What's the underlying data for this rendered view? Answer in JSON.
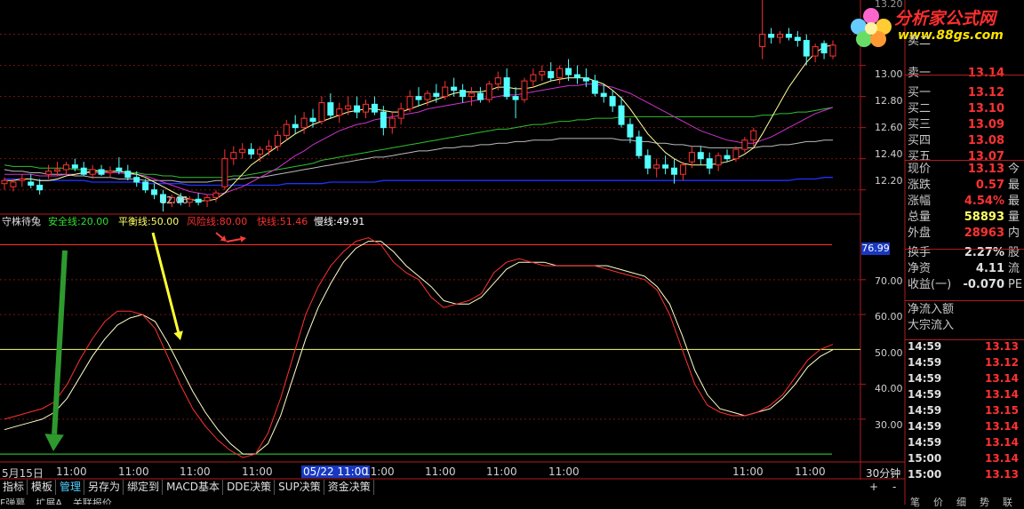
{
  "colors": {
    "up": "#ff3232",
    "down": "#54ffff",
    "red": "#ff3030",
    "yellow": "#ffff66",
    "green": "#30c030",
    "purple": "#cc33cc",
    "white": "#dddddd",
    "blue": "#2030ff",
    "grid": "#7a1414"
  },
  "price_panel": {
    "y_ticks": [
      "13.00",
      "12.80",
      "12.60",
      "12.40",
      "12.20"
    ],
    "top_tick_partial": "13.20",
    "low_marker": "12.06"
  },
  "indicator": {
    "name": "守株待兔",
    "lines": [
      {
        "label": "安全线:",
        "value": "20.00",
        "color": "#30e030"
      },
      {
        "label": "平衡线:",
        "value": "50.00",
        "color": "#ffff66"
      },
      {
        "label": "风险线:",
        "value": "80.00",
        "color": "#ff3030"
      },
      {
        "label": "快线:",
        "value": "51.46",
        "color": "#ff3030"
      },
      {
        "label": "慢线:",
        "value": "49.91",
        "color": "#ffffff"
      }
    ],
    "y_ticks": [
      "70.00",
      "60.00",
      "50.00",
      "40.00",
      "30.00"
    ],
    "current_value_box": "76.99"
  },
  "time_axis": {
    "labels": [
      "5月15日",
      "11:00",
      "11:00",
      "11:00",
      "11:00",
      "05/22 11:00",
      "11:00",
      "11:00",
      "11:00",
      "11:00",
      "11:00",
      "11:00"
    ],
    "highlight_index": 5,
    "period": "30分钟"
  },
  "tabs": [
    "指标",
    "模板",
    "管理",
    "另存为",
    "绑定到",
    "MACD基本",
    "DDE决策",
    "SUP决策",
    "资金决策"
  ],
  "tabs_row2": [
    "F弹幕",
    "扩展A",
    "关联报价"
  ],
  "active_tab_index": 2,
  "scroll_controls": [
    "+",
    "-"
  ],
  "logo": {
    "title": "分析家公式网",
    "url": "www.88gs.com"
  },
  "quote": {
    "order_book": [
      {
        "k": "卖二",
        "v": "",
        "c": "#ff3232"
      },
      {
        "k": "卖一",
        "v": "13.14",
        "c": "#ff3232"
      },
      {
        "k": "买一",
        "v": "13.12",
        "c": "#ff3232"
      },
      {
        "k": "买二",
        "v": "13.10",
        "c": "#ff3232"
      },
      {
        "k": "买三",
        "v": "13.09",
        "c": "#ff3232"
      },
      {
        "k": "买四",
        "v": "13.08",
        "c": "#ff3232"
      },
      {
        "k": "买五",
        "v": "13.07",
        "c": "#ff3232"
      }
    ],
    "stats": [
      {
        "k": "现价",
        "v": "13.13",
        "c": "#ff3232",
        "ex": "今"
      },
      {
        "k": "涨跌",
        "v": "0.57",
        "c": "#ff3232",
        "ex": "最"
      },
      {
        "k": "涨幅",
        "v": "4.54%",
        "c": "#ff3232",
        "ex": "最"
      },
      {
        "k": "总量",
        "v": "58893",
        "c": "#ffff66",
        "ex": "量"
      },
      {
        "k": "外盘",
        "v": "28963",
        "c": "#ff3232",
        "ex": "内"
      },
      {
        "k": "换手",
        "v": "2.27%",
        "c": "#e0e0e0",
        "ex": "股"
      },
      {
        "k": "净资",
        "v": "4.11",
        "c": "#e0e0e0",
        "ex": "流"
      },
      {
        "k": "收益(一)",
        "v": "-0.070",
        "c": "#e0e0e0",
        "ex": "PE"
      }
    ],
    "flow": [
      "净流入额",
      "大宗流入"
    ]
  },
  "ticks": [
    {
      "t": "14:59",
      "p": "13.13"
    },
    {
      "t": "14:59",
      "p": "13.12"
    },
    {
      "t": "14:59",
      "p": "13.14"
    },
    {
      "t": "14:59",
      "p": "13.14"
    },
    {
      "t": "14:59",
      "p": "13.15"
    },
    {
      "t": "14:59",
      "p": "13.14"
    },
    {
      "t": "14:59",
      "p": "13.14"
    },
    {
      "t": "15:00",
      "p": "13.14"
    },
    {
      "t": "15:00",
      "p": "13.13"
    }
  ],
  "bottom_tabs": [
    "笔",
    "价",
    "细",
    "势",
    "联"
  ],
  "chart_data": {
    "type": "candlestick",
    "price_axis": {
      "ylim": [
        12.05,
        13.42
      ]
    },
    "ohlc": [
      [
        12.24,
        12.28,
        12.2,
        12.26
      ],
      [
        12.22,
        12.27,
        12.19,
        12.25
      ],
      [
        12.26,
        12.3,
        12.22,
        12.27
      ],
      [
        12.25,
        12.3,
        12.21,
        12.23
      ],
      [
        12.23,
        12.27,
        12.17,
        12.2
      ],
      [
        12.3,
        12.36,
        12.27,
        12.32
      ],
      [
        12.32,
        12.38,
        12.29,
        12.33
      ],
      [
        12.33,
        12.38,
        12.3,
        12.36
      ],
      [
        12.36,
        12.4,
        12.32,
        12.34
      ],
      [
        12.34,
        12.38,
        12.29,
        12.3
      ],
      [
        12.3,
        12.36,
        12.27,
        12.33
      ],
      [
        12.33,
        12.36,
        12.29,
        12.3
      ],
      [
        12.31,
        12.35,
        12.28,
        12.32
      ],
      [
        12.34,
        12.41,
        12.3,
        12.32
      ],
      [
        12.32,
        12.36,
        12.26,
        12.28
      ],
      [
        12.28,
        12.32,
        12.22,
        12.25
      ],
      [
        12.25,
        12.27,
        12.18,
        12.2
      ],
      [
        12.2,
        12.24,
        12.14,
        12.17
      ],
      [
        12.17,
        12.2,
        12.06,
        12.12
      ],
      [
        12.12,
        12.17,
        12.09,
        12.15
      ],
      [
        12.15,
        12.18,
        12.1,
        12.12
      ],
      [
        12.12,
        12.16,
        12.09,
        12.14
      ],
      [
        12.14,
        12.18,
        12.1,
        12.12
      ],
      [
        12.13,
        12.17,
        12.09,
        12.15
      ],
      [
        12.15,
        12.2,
        12.12,
        12.18
      ],
      [
        12.22,
        12.46,
        12.2,
        12.4
      ],
      [
        12.4,
        12.48,
        12.36,
        12.44
      ],
      [
        12.44,
        12.5,
        12.4,
        12.46
      ],
      [
        12.46,
        12.5,
        12.4,
        12.43
      ],
      [
        12.43,
        12.48,
        12.38,
        12.46
      ],
      [
        12.46,
        12.52,
        12.42,
        12.48
      ],
      [
        12.48,
        12.58,
        12.45,
        12.55
      ],
      [
        12.55,
        12.65,
        12.52,
        12.62
      ],
      [
        12.62,
        12.68,
        12.56,
        12.6
      ],
      [
        12.6,
        12.7,
        12.56,
        12.66
      ],
      [
        12.66,
        12.72,
        12.6,
        12.64
      ],
      [
        12.64,
        12.8,
        12.62,
        12.76
      ],
      [
        12.76,
        12.82,
        12.66,
        12.68
      ],
      [
        12.68,
        12.76,
        12.63,
        12.72
      ],
      [
        12.72,
        12.8,
        12.68,
        12.74
      ],
      [
        12.74,
        12.8,
        12.66,
        12.7
      ],
      [
        12.7,
        12.78,
        12.66,
        12.75
      ],
      [
        12.75,
        12.8,
        12.68,
        12.7
      ],
      [
        12.7,
        12.74,
        12.55,
        12.6
      ],
      [
        12.6,
        12.7,
        12.56,
        12.66
      ],
      [
        12.66,
        12.76,
        12.62,
        12.72
      ],
      [
        12.72,
        12.84,
        12.7,
        12.8
      ],
      [
        12.8,
        12.86,
        12.74,
        12.78
      ],
      [
        12.78,
        12.84,
        12.74,
        12.82
      ],
      [
        12.82,
        12.88,
        12.76,
        12.8
      ],
      [
        12.8,
        12.9,
        12.78,
        12.86
      ],
      [
        12.86,
        12.92,
        12.8,
        12.84
      ],
      [
        12.84,
        12.88,
        12.76,
        12.8
      ],
      [
        12.8,
        12.86,
        12.74,
        12.82
      ],
      [
        12.82,
        12.86,
        12.76,
        12.78
      ],
      [
        12.78,
        12.9,
        12.76,
        12.88
      ],
      [
        12.88,
        12.96,
        12.84,
        12.92
      ],
      [
        12.92,
        12.98,
        12.78,
        12.8
      ],
      [
        12.8,
        12.86,
        12.66,
        12.78
      ],
      [
        12.78,
        12.92,
        12.76,
        12.9
      ],
      [
        12.9,
        12.98,
        12.86,
        12.94
      ],
      [
        12.94,
        13.0,
        12.9,
        12.96
      ],
      [
        12.96,
        13.02,
        12.9,
        12.92
      ],
      [
        12.92,
        13.0,
        12.88,
        12.98
      ],
      [
        12.98,
        13.04,
        12.9,
        12.94
      ],
      [
        12.94,
        13.0,
        12.88,
        12.92
      ],
      [
        12.92,
        12.98,
        12.86,
        12.9
      ],
      [
        12.9,
        12.94,
        12.8,
        12.82
      ],
      [
        12.82,
        12.88,
        12.76,
        12.8
      ],
      [
        12.8,
        12.84,
        12.7,
        12.74
      ],
      [
        12.74,
        12.8,
        12.6,
        12.62
      ],
      [
        12.62,
        12.66,
        12.5,
        12.54
      ],
      [
        12.54,
        12.58,
        12.4,
        12.42
      ],
      [
        12.42,
        12.46,
        12.3,
        12.34
      ],
      [
        12.34,
        12.4,
        12.28,
        12.36
      ],
      [
        12.36,
        12.42,
        12.3,
        12.34
      ],
      [
        12.34,
        12.4,
        12.24,
        12.3
      ],
      [
        12.3,
        12.38,
        12.26,
        12.36
      ],
      [
        12.38,
        12.48,
        12.34,
        12.44
      ],
      [
        12.44,
        12.48,
        12.36,
        12.4
      ],
      [
        12.4,
        12.44,
        12.3,
        12.34
      ],
      [
        12.36,
        12.44,
        12.32,
        12.42
      ],
      [
        12.42,
        12.46,
        12.38,
        12.4
      ],
      [
        12.4,
        12.48,
        12.38,
        12.46
      ],
      [
        12.46,
        12.54,
        12.44,
        12.52
      ],
      [
        12.52,
        12.6,
        12.48,
        12.58
      ],
      [
        13.12,
        13.42,
        13.04,
        13.2
      ],
      [
        13.2,
        13.24,
        13.14,
        13.18
      ],
      [
        13.18,
        13.22,
        13.14,
        13.2
      ],
      [
        13.2,
        13.24,
        13.16,
        13.18
      ],
      [
        13.18,
        13.22,
        13.12,
        13.16
      ],
      [
        13.16,
        13.2,
        13.0,
        13.06
      ],
      [
        13.06,
        13.14,
        13.02,
        13.12
      ],
      [
        13.14,
        13.16,
        13.04,
        13.08
      ],
      [
        13.06,
        13.16,
        13.04,
        13.13
      ]
    ],
    "ma_short": [
      12.26,
      12.26,
      12.27,
      12.27,
      12.26,
      12.26,
      12.27,
      12.29,
      12.3,
      12.31,
      12.32,
      12.32,
      12.32,
      12.32,
      12.31,
      12.3,
      12.28,
      12.25,
      12.22,
      12.19,
      12.16,
      12.14,
      12.13,
      12.13,
      12.14,
      12.18,
      12.24,
      12.3,
      12.36,
      12.4,
      12.44,
      12.48,
      12.52,
      12.56,
      12.59,
      12.62,
      12.64,
      12.66,
      12.68,
      12.7,
      12.71,
      12.72,
      12.72,
      12.71,
      12.7,
      12.7,
      12.72,
      12.74,
      12.76,
      12.78,
      12.8,
      12.82,
      12.83,
      12.83,
      12.83,
      12.84,
      12.86,
      12.86,
      12.85,
      12.85,
      12.86,
      12.88,
      12.9,
      12.91,
      12.92,
      12.92,
      12.92,
      12.9,
      12.88,
      12.84,
      12.79,
      12.72,
      12.64,
      12.56,
      12.5,
      12.44,
      12.4,
      12.37,
      12.36,
      12.36,
      12.36,
      12.37,
      12.38,
      12.4,
      12.43,
      12.47,
      12.56,
      12.66,
      12.76,
      12.86,
      12.94,
      13.02,
      13.08,
      13.12,
      13.13
    ],
    "ma_mid": [
      12.3,
      12.3,
      12.3,
      12.3,
      12.29,
      12.29,
      12.29,
      12.3,
      12.3,
      12.31,
      12.31,
      12.31,
      12.31,
      12.31,
      12.3,
      12.3,
      12.29,
      12.27,
      12.25,
      12.23,
      12.21,
      12.19,
      12.18,
      12.17,
      12.17,
      12.18,
      12.2,
      12.22,
      12.25,
      12.28,
      12.31,
      12.34,
      12.38,
      12.42,
      12.45,
      12.49,
      12.52,
      12.55,
      12.58,
      12.6,
      12.62,
      12.63,
      12.65,
      12.66,
      12.67,
      12.68,
      12.69,
      12.7,
      12.72,
      12.73,
      12.74,
      12.75,
      12.76,
      12.77,
      12.78,
      12.79,
      12.8,
      12.81,
      12.81,
      12.82,
      12.83,
      12.84,
      12.85,
      12.86,
      12.87,
      12.87,
      12.88,
      12.88,
      12.87,
      12.86,
      12.84,
      12.82,
      12.79,
      12.76,
      12.73,
      12.7,
      12.67,
      12.64,
      12.61,
      12.58,
      12.56,
      12.54,
      12.52,
      12.51,
      12.5,
      12.5,
      12.52,
      12.54,
      12.57,
      12.6,
      12.63,
      12.66,
      12.69,
      12.71,
      12.73
    ],
    "ma_long_green": [
      12.36,
      12.35,
      12.35,
      12.35,
      12.34,
      12.34,
      12.34,
      12.34,
      12.33,
      12.33,
      12.33,
      12.32,
      12.32,
      12.32,
      12.31,
      12.31,
      12.3,
      12.3,
      12.29,
      12.29,
      12.28,
      12.28,
      12.28,
      12.28,
      12.28,
      12.28,
      12.29,
      12.29,
      12.3,
      12.31,
      12.32,
      12.33,
      12.34,
      12.35,
      12.36,
      12.37,
      12.39,
      12.4,
      12.41,
      12.42,
      12.43,
      12.44,
      12.45,
      12.46,
      12.47,
      12.48,
      12.49,
      12.5,
      12.51,
      12.52,
      12.53,
      12.54,
      12.55,
      12.56,
      12.57,
      12.58,
      12.59,
      12.59,
      12.6,
      12.61,
      12.62,
      12.62,
      12.63,
      12.64,
      12.64,
      12.65,
      12.65,
      12.66,
      12.66,
      12.66,
      12.67,
      12.67,
      12.67,
      12.67,
      12.67,
      12.67,
      12.67,
      12.67,
      12.67,
      12.67,
      12.67,
      12.67,
      12.67,
      12.67,
      12.67,
      12.67,
      12.68,
      12.68,
      12.69,
      12.69,
      12.7,
      12.7,
      12.71,
      12.72,
      12.73
    ],
    "ma_long_white": [
      12.33,
      12.32,
      12.32,
      12.31,
      12.31,
      12.3,
      12.3,
      12.3,
      12.29,
      12.29,
      12.28,
      12.28,
      12.28,
      12.27,
      12.27,
      12.27,
      12.26,
      12.26,
      12.26,
      12.26,
      12.25,
      12.25,
      12.25,
      12.25,
      12.26,
      12.26,
      12.27,
      12.27,
      12.28,
      12.28,
      12.29,
      12.3,
      12.31,
      12.32,
      12.33,
      12.34,
      12.35,
      12.36,
      12.37,
      12.38,
      12.39,
      12.4,
      12.41,
      12.41,
      12.42,
      12.43,
      12.44,
      12.45,
      12.45,
      12.46,
      12.47,
      12.47,
      12.48,
      12.48,
      12.49,
      12.49,
      12.5,
      12.5,
      12.51,
      12.51,
      12.52,
      12.52,
      12.52,
      12.53,
      12.53,
      12.53,
      12.53,
      12.53,
      12.53,
      12.53,
      12.52,
      12.52,
      12.51,
      12.51,
      12.5,
      12.5,
      12.49,
      12.49,
      12.48,
      12.48,
      12.47,
      12.47,
      12.47,
      12.47,
      12.47,
      12.47,
      12.48,
      12.48,
      12.49,
      12.49,
      12.5,
      12.51,
      12.51,
      12.52,
      12.52
    ],
    "ma_long_blue": [
      12.27,
      12.27,
      12.27,
      12.27,
      12.26,
      12.26,
      12.26,
      12.26,
      12.26,
      12.26,
      12.25,
      12.25,
      12.25,
      12.25,
      12.25,
      12.25,
      12.24,
      12.24,
      12.24,
      12.24,
      12.24,
      12.23,
      12.23,
      12.23,
      12.23,
      12.23,
      12.23,
      12.23,
      12.23,
      12.23,
      12.23,
      12.23,
      12.24,
      12.24,
      12.24,
      12.24,
      12.24,
      12.25,
      12.25,
      12.25,
      12.25,
      12.25,
      12.25,
      12.26,
      12.26,
      12.26,
      12.26,
      12.26,
      12.26,
      12.26,
      12.26,
      12.26,
      12.26,
      12.26,
      12.26,
      12.26,
      12.26,
      12.26,
      12.26,
      12.26,
      12.26,
      12.26,
      12.26,
      12.26,
      12.26,
      12.26,
      12.26,
      12.26,
      12.26,
      12.26,
      12.26,
      12.26,
      12.26,
      12.26,
      12.26,
      12.26,
      12.26,
      12.26,
      12.26,
      12.26,
      12.26,
      12.26,
      12.26,
      12.26,
      12.26,
      12.26,
      12.26,
      12.26,
      12.26,
      12.26,
      12.27,
      12.27,
      12.27,
      12.28,
      12.28
    ],
    "indicator_axis": {
      "ylim": [
        18,
        86
      ],
      "levels": {
        "safe": 20,
        "balance": 50,
        "risk": 80
      }
    },
    "fast": [
      30,
      31,
      32,
      33,
      35,
      40,
      47,
      53,
      58,
      61,
      61,
      60,
      56,
      48,
      40,
      33,
      28,
      24,
      21,
      19,
      20,
      26,
      36,
      48,
      60,
      68,
      74,
      78,
      81,
      82,
      80,
      75,
      72,
      70,
      65,
      62,
      63,
      64,
      66,
      72,
      75,
      76,
      75,
      74,
      74,
      74,
      74,
      74,
      73,
      72,
      71,
      70,
      67,
      60,
      50,
      40,
      34,
      32,
      31,
      31,
      32,
      34,
      37,
      42,
      47,
      50,
      51.46
    ],
    "slow": [
      27,
      28,
      29,
      30,
      32,
      36,
      42,
      48,
      53,
      57,
      59,
      60,
      58,
      52,
      45,
      38,
      32,
      27,
      23,
      20,
      20,
      23,
      31,
      42,
      53,
      62,
      69,
      75,
      79,
      81,
      81,
      78,
      74,
      71,
      68,
      64,
      63,
      63,
      65,
      69,
      73,
      75,
      75,
      75,
      74,
      74,
      74,
      74,
      74,
      73,
      72,
      71,
      68,
      63,
      54,
      44,
      37,
      33,
      32,
      31,
      32,
      33,
      36,
      40,
      45,
      48,
      49.91
    ]
  }
}
